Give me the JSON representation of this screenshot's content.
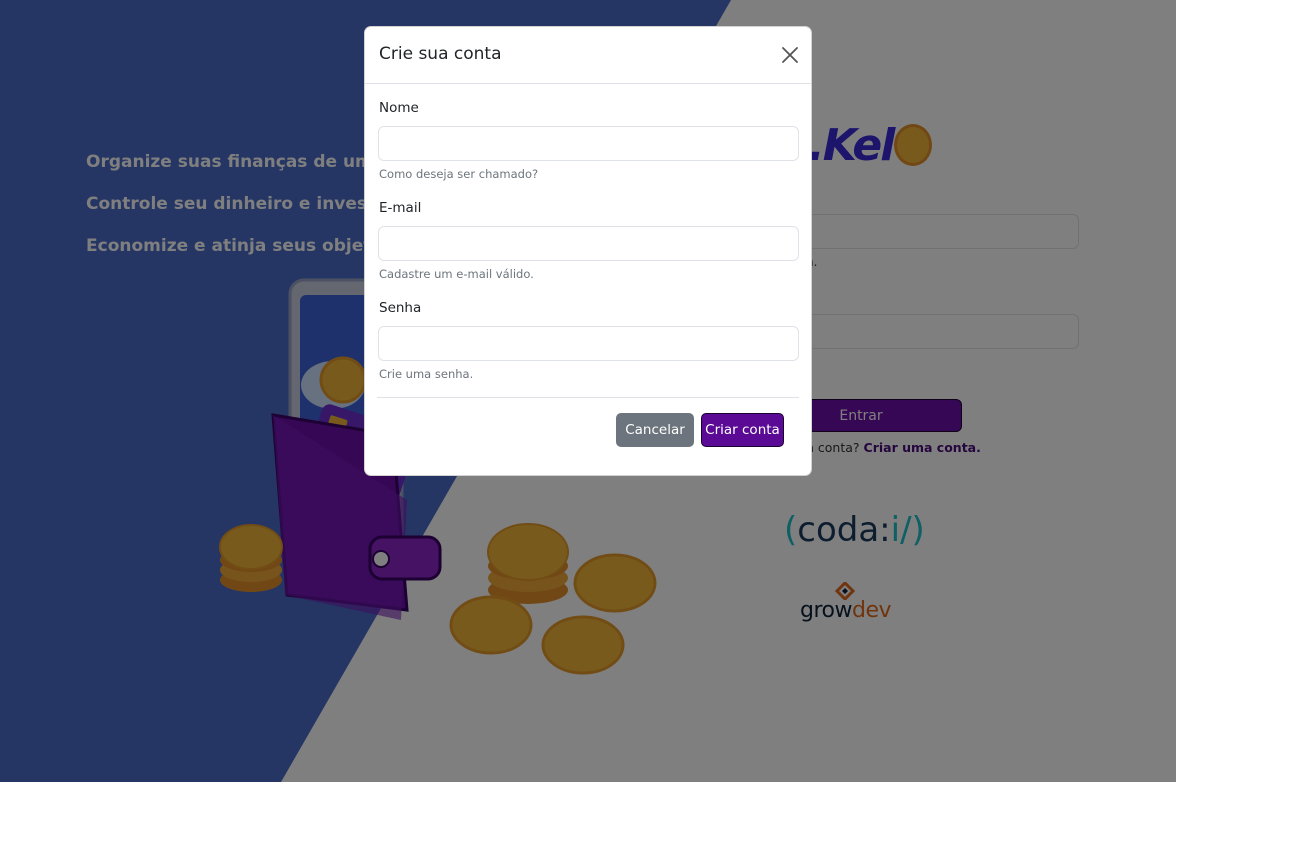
{
  "background": {
    "taglines": [
      "Organize suas finanças de uma for",
      "Controle seu dinheiro e investimer",
      "Economize e atinja seus objetivos."
    ]
  },
  "login": {
    "logo_text": ".Kel",
    "email_help": "n.",
    "enter_label": "Entrar",
    "signup_prompt": "n conta? ",
    "signup_link": "Criar uma conta.",
    "partners": {
      "codai_left": "(",
      "codai_name": "coda:",
      "codai_slash": "i/",
      "codai_right": ")",
      "growdev_grow": "grow",
      "growdev_dev": "dev"
    }
  },
  "modal": {
    "title": "Crie sua conta",
    "fields": {
      "name": {
        "label": "Nome",
        "value": "",
        "help": "Como deseja ser chamado?"
      },
      "email": {
        "label": "E-mail",
        "value": "",
        "help": "Cadastre um e-mail válido."
      },
      "password": {
        "label": "Senha",
        "value": "",
        "help": "Crie uma senha."
      }
    },
    "cancel_label": "Cancelar",
    "create_label": "Criar conta"
  },
  "colors": {
    "primary_purple": "#5a0a94",
    "secondary_gray": "#6c757d",
    "left_panel_blue": "#4a6bc9"
  }
}
